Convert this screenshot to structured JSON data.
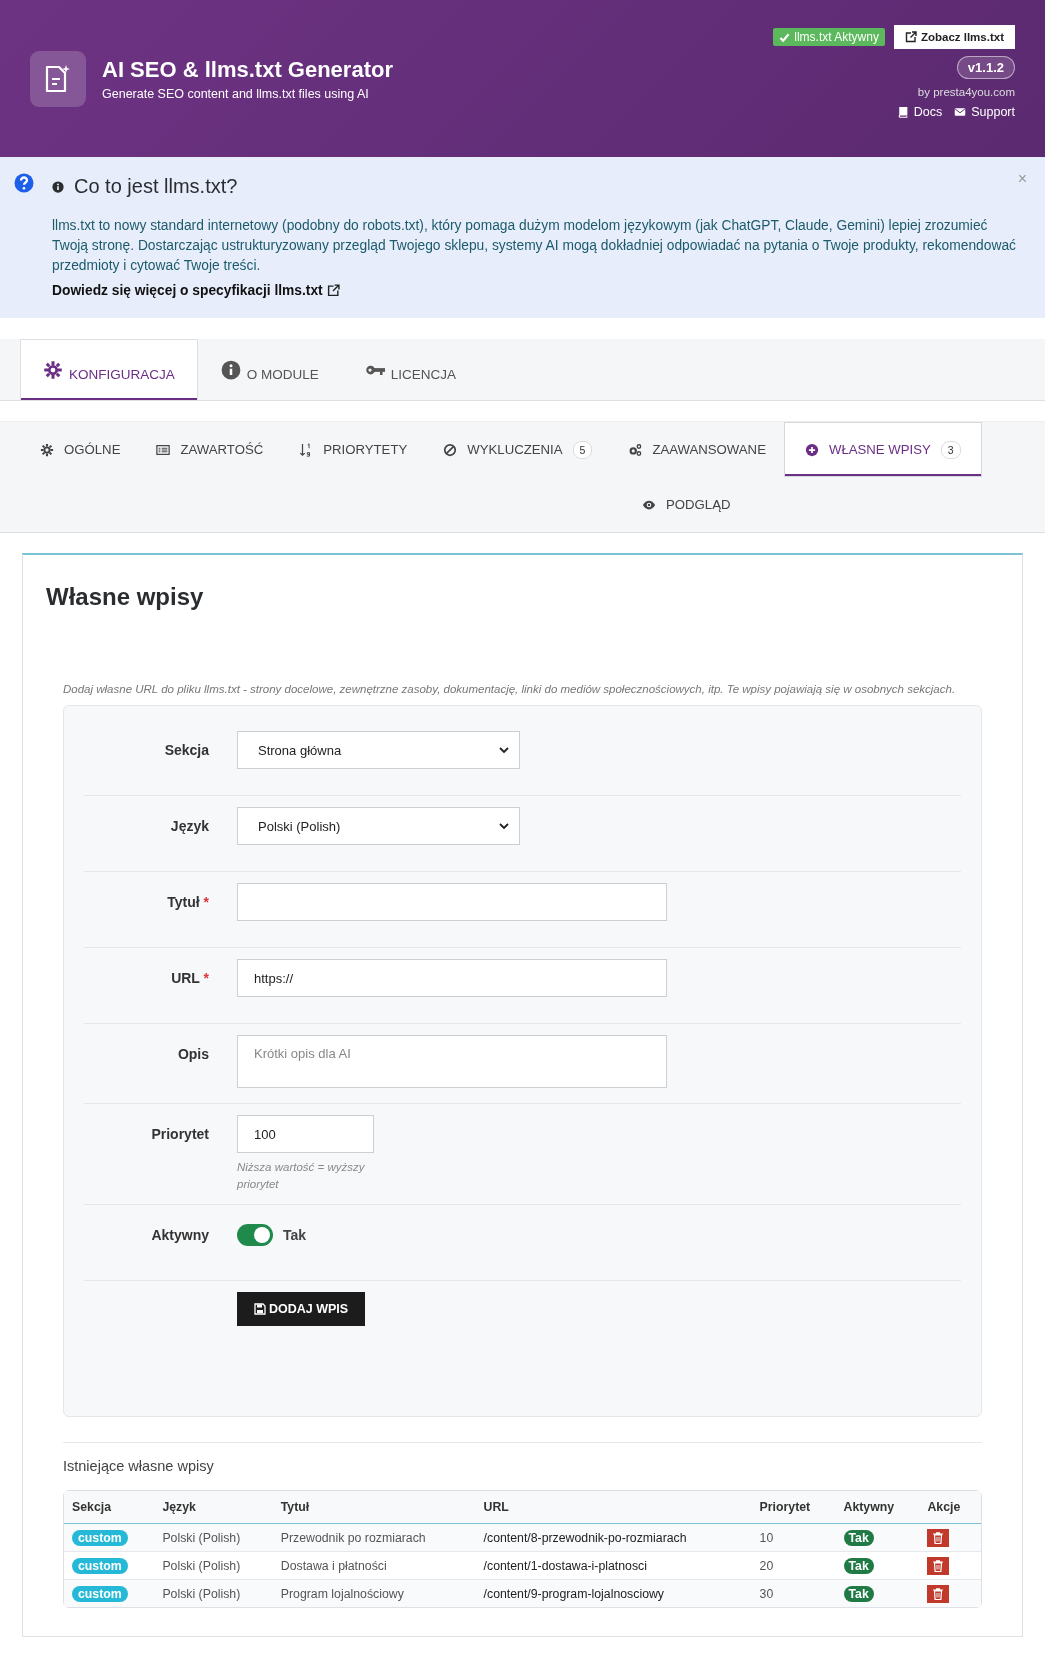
{
  "header": {
    "title": "AI SEO & llms.txt Generator",
    "subtitle": "Generate SEO content and llms.txt files using AI",
    "status_badge": "llms.txt Aktywny",
    "view_button": "Zobacz llms.txt",
    "version": "v1.1.2",
    "author": "by presta4you.com",
    "links": [
      {
        "label": "Docs",
        "kind": "docs"
      },
      {
        "label": "Support",
        "kind": "support"
      }
    ]
  },
  "info": {
    "title": "Co to jest llms.txt?",
    "close": "×",
    "text": "llms.txt to nowy standard internetowy (podobny do robots.txt), który pomaga dużym modelom językowym (jak ChatGPT, Claude, Gemini) lepiej zrozumieć Twoją stronę. Dostarczając ustrukturyzowany przegląd Twojego sklepu, systemy AI mogą dokładniej odpowiadać na pytania o Twoje produkty, rekomendować przedmioty i cytować Twoje treści.",
    "link": "Dowiedz się więcej o specyfikacji llms.txt"
  },
  "main_tabs": [
    {
      "label": "KONFIGURACJA",
      "kind": "gear",
      "selected": true
    },
    {
      "label": "O MODULE",
      "kind": "info",
      "selected": false
    },
    {
      "label": "LICENCJA",
      "kind": "key",
      "selected": false
    }
  ],
  "sub_tabs": [
    {
      "label": "OGÓLNE",
      "kind": "gear",
      "selected": false
    },
    {
      "label": "ZAWARTOŚĆ",
      "kind": "list",
      "selected": false
    },
    {
      "label": "PRIORYTETY",
      "kind": "sort",
      "selected": false
    },
    {
      "label": "WYKLUCZENIA",
      "kind": "ban",
      "selected": false,
      "count": "5"
    },
    {
      "label": "ZAAWANSOWANE",
      "kind": "gears",
      "selected": false
    },
    {
      "label": "WŁASNE WPISY",
      "kind": "plus",
      "selected": true,
      "count": "3"
    },
    {
      "label": "PODGLĄD",
      "kind": "eye",
      "selected": false
    }
  ],
  "panel": {
    "heading": "Własne wpisy",
    "description": "Dodaj własne URL do pliku llms.txt - strony docelowe, zewnętrzne zasoby, dokumentację, linki do mediów społecznościowych, itp. Te wpisy pojawiają się w osobnych sekcjach.",
    "fields": [
      {
        "kind": "select",
        "label": "Sekcja",
        "required": false,
        "value": "Strona główna"
      },
      {
        "kind": "select",
        "label": "Język",
        "required": false,
        "value": "Polski (Polish)"
      },
      {
        "kind": "text",
        "label": "Tytuł",
        "required": true
      },
      {
        "kind": "text",
        "label": "URL",
        "required": true,
        "value": "https://"
      },
      {
        "kind": "textarea",
        "label": "Opis",
        "required": false,
        "placeholder": "Krótki opis dla AI"
      },
      {
        "kind": "number",
        "label": "Priorytet",
        "required": false,
        "value": "100",
        "help": "Niższa wartość = wyższy priorytet"
      },
      {
        "kind": "toggle",
        "label": "Aktywny",
        "required": false,
        "on": true,
        "value": "Tak"
      }
    ],
    "submit": "DODAJ WPIS",
    "required_mark": "*"
  },
  "existing": {
    "title": "Istniejące własne wpisy",
    "columns": [
      "Sekcja",
      "Język",
      "Tytuł",
      "URL",
      "Priorytet",
      "Aktywny",
      "Akcje"
    ],
    "rows": [
      {
        "section": "custom",
        "language": "Polski (Polish)",
        "title": "Przewodnik po rozmiarach",
        "url": "/content/8-przewodnik-po-rozmiarach",
        "priority": "10",
        "active": true,
        "active_label": "Tak"
      },
      {
        "section": "custom",
        "language": "Polski (Polish)",
        "title": "Dostawa i płatności",
        "url": "/content/1-dostawa-i-platnosci",
        "priority": "20",
        "active": true,
        "active_label": "Tak"
      },
      {
        "section": "custom",
        "language": "Polski (Polish)",
        "title": "Program lojalnościowy",
        "url": "/content/9-program-lojalnosciowy",
        "priority": "30",
        "active": true,
        "active_label": "Tak"
      }
    ]
  }
}
